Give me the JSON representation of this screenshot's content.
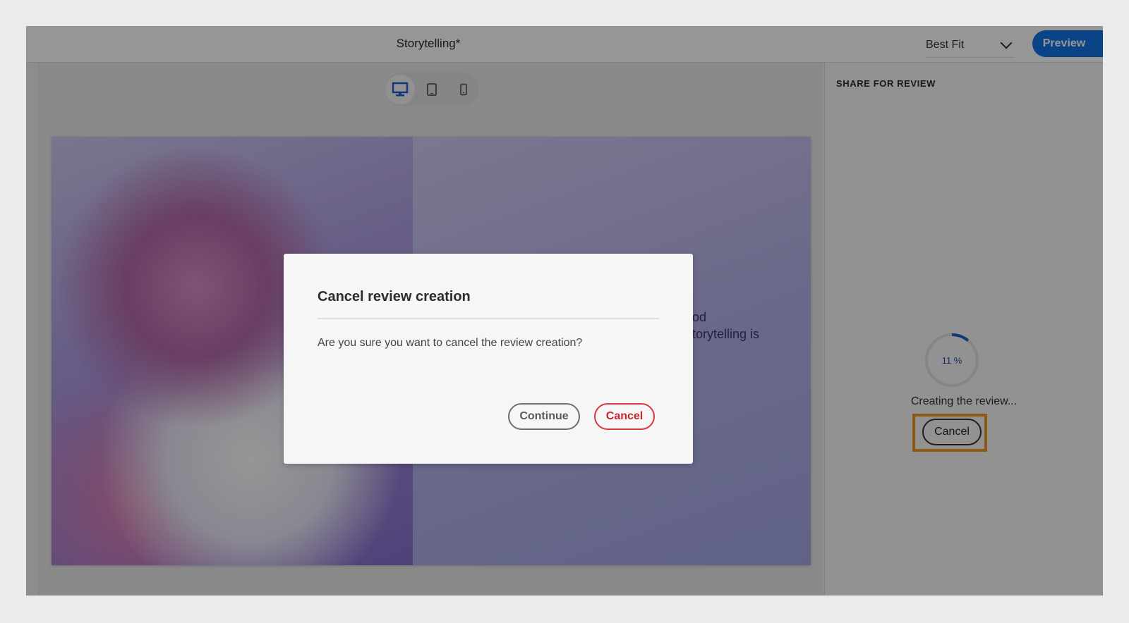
{
  "header": {
    "document_title": "Storytelling*",
    "zoom_select": {
      "value": "Best Fit",
      "icon": "chevron-down-icon"
    },
    "preview_label": "Preview",
    "accent_color": "#1473e6"
  },
  "device_toggle": {
    "options": [
      {
        "name": "desktop",
        "icon": "desktop-icon",
        "active": true
      },
      {
        "name": "tablet",
        "icon": "tablet-icon",
        "active": false
      },
      {
        "name": "mobile",
        "icon": "mobile-icon",
        "active": false
      }
    ]
  },
  "slide": {
    "visible_text_line1": "nt- good",
    "visible_text_line2": "why storytelling is"
  },
  "share_panel": {
    "title": "SHARE FOR REVIEW",
    "progress_percent": 11,
    "progress_label": "11 %",
    "status": "Creating the review...",
    "cancel_label": "Cancel",
    "highlight_color": "#f29a1f"
  },
  "dialog": {
    "title": "Cancel review creation",
    "message": "Are you sure you want to cancel the review creation?",
    "continue_label": "Continue",
    "cancel_label": "Cancel",
    "cancel_color": "#d7373f"
  }
}
